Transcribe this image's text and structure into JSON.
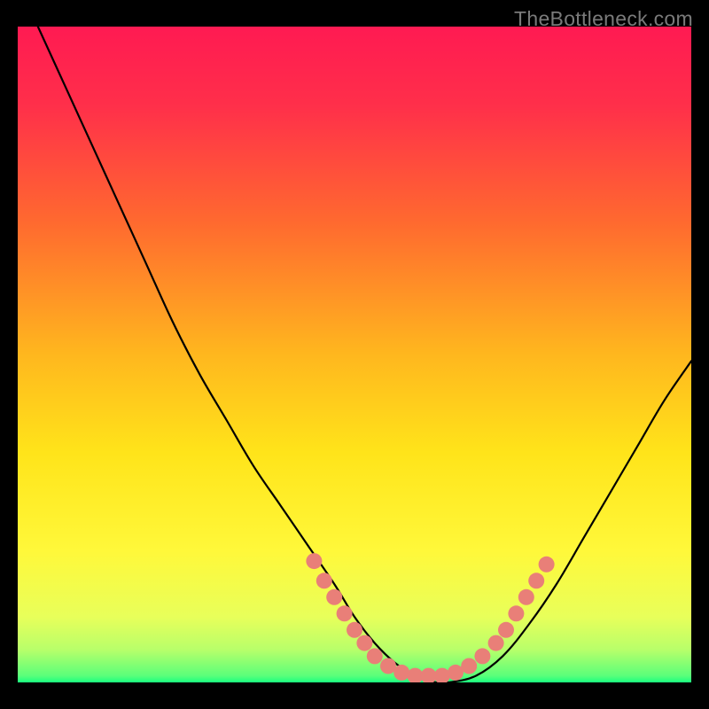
{
  "watermark": "TheBottleneck.com",
  "chart_data": {
    "type": "line",
    "title": "",
    "xlabel": "",
    "ylabel": "",
    "xlim": [
      0,
      100
    ],
    "ylim": [
      0,
      100
    ],
    "gradient_stops": [
      {
        "offset": 0.0,
        "color": "#ff1a52"
      },
      {
        "offset": 0.12,
        "color": "#ff2f4a"
      },
      {
        "offset": 0.3,
        "color": "#ff6a2f"
      },
      {
        "offset": 0.5,
        "color": "#ffb71e"
      },
      {
        "offset": 0.65,
        "color": "#ffe41a"
      },
      {
        "offset": 0.8,
        "color": "#fff83a"
      },
      {
        "offset": 0.9,
        "color": "#e8ff5a"
      },
      {
        "offset": 0.95,
        "color": "#b8ff6a"
      },
      {
        "offset": 0.99,
        "color": "#5aff7a"
      },
      {
        "offset": 1.0,
        "color": "#1aff80"
      }
    ],
    "series": [
      {
        "name": "bottleneck-curve",
        "x": [
          3,
          7,
          11,
          15,
          19,
          23,
          27,
          31,
          35,
          39,
          43,
          47,
          50,
          53,
          56,
          59,
          62,
          64,
          68,
          72,
          76,
          80,
          84,
          88,
          92,
          96,
          100
        ],
        "y": [
          100,
          91,
          82,
          73,
          64,
          55,
          47,
          40,
          33,
          27,
          21,
          15,
          10,
          6,
          3,
          1,
          0,
          0,
          1,
          4,
          9,
          15,
          22,
          29,
          36,
          43,
          49
        ]
      }
    ],
    "markers": {
      "name": "highlight-dots",
      "color": "#e97f78",
      "radius": 9,
      "points": [
        {
          "x": 44,
          "y": 18.5
        },
        {
          "x": 45.5,
          "y": 15.5
        },
        {
          "x": 47,
          "y": 13
        },
        {
          "x": 48.5,
          "y": 10.5
        },
        {
          "x": 50,
          "y": 8
        },
        {
          "x": 51.5,
          "y": 6
        },
        {
          "x": 53,
          "y": 4
        },
        {
          "x": 55,
          "y": 2.5
        },
        {
          "x": 57,
          "y": 1.5
        },
        {
          "x": 59,
          "y": 1
        },
        {
          "x": 61,
          "y": 1
        },
        {
          "x": 63,
          "y": 1
        },
        {
          "x": 65,
          "y": 1.5
        },
        {
          "x": 67,
          "y": 2.5
        },
        {
          "x": 69,
          "y": 4
        },
        {
          "x": 71,
          "y": 6
        },
        {
          "x": 72.5,
          "y": 8
        },
        {
          "x": 74,
          "y": 10.5
        },
        {
          "x": 75.5,
          "y": 13
        },
        {
          "x": 77,
          "y": 15.5
        },
        {
          "x": 78.5,
          "y": 18
        }
      ]
    }
  }
}
